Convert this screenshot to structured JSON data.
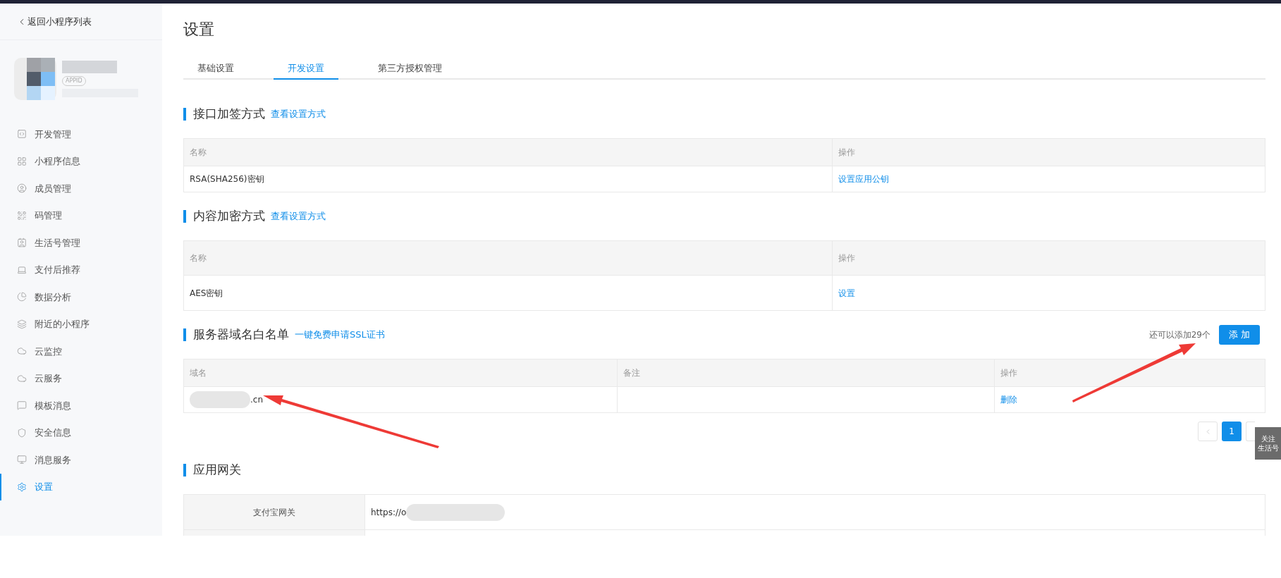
{
  "sidebar": {
    "back_link": "返回小程序列表",
    "app": {
      "badge": "APPID"
    },
    "items": [
      {
        "label": "开发管理",
        "selected": false
      },
      {
        "label": "小程序信息",
        "selected": false
      },
      {
        "label": "成员管理",
        "selected": false
      },
      {
        "label": "码管理",
        "selected": false
      },
      {
        "label": "生活号管理",
        "selected": false
      },
      {
        "label": "支付后推荐",
        "selected": false
      },
      {
        "label": "数据分析",
        "selected": false
      },
      {
        "label": "附近的小程序",
        "selected": false
      },
      {
        "label": "云监控",
        "selected": false
      },
      {
        "label": "云服务",
        "selected": false
      },
      {
        "label": "模板消息",
        "selected": false
      },
      {
        "label": "安全信息",
        "selected": false
      },
      {
        "label": "消息服务",
        "selected": false
      },
      {
        "label": "设置",
        "selected": true
      }
    ]
  },
  "page_title": "设置",
  "tabs": [
    {
      "label": "基础设置",
      "selected": false
    },
    {
      "label": "开发设置",
      "selected": true
    },
    {
      "label": "第三方授权管理",
      "selected": false
    }
  ],
  "sections": [
    {
      "title": "接口加签方式",
      "link": "查看设置方式",
      "table": {
        "columns": [
          "名称",
          "操作"
        ],
        "rows": [
          [
            {
              "kind": "text",
              "text": "RSA(SHA256)密钥"
            },
            {
              "kind": "link",
              "text": "设置应用公钥"
            }
          ]
        ]
      }
    },
    {
      "title": "内容加密方式",
      "link": "查看设置方式",
      "table": {
        "columns": [
          "名称",
          "操作"
        ],
        "rows": [
          [
            {
              "kind": "text",
              "text": "AES密钥"
            },
            {
              "kind": "link",
              "text": "设置"
            }
          ]
        ]
      }
    },
    {
      "title": "服务器域名白名单",
      "link": "一键免费申请SSL证书",
      "remaining": "还可以添加29个",
      "add_button": "添 加",
      "table": {
        "columns": [
          "域名",
          "备注",
          "操作"
        ],
        "rows": [
          [
            {
              "kind": "masked",
              "text": ".cn"
            },
            {
              "kind": "text",
              "text": ""
            },
            {
              "kind": "link",
              "text": "删除"
            }
          ]
        ]
      },
      "pagination": {
        "pages": [
          {
            "label": "1",
            "selected": true
          }
        ]
      }
    },
    {
      "title": "应用网关",
      "kv_rows": [
        {
          "label": "支付宝网关",
          "value": "https://o"
        }
      ]
    }
  ],
  "float_button": {
    "lines": [
      "关注",
      "生活号"
    ]
  }
}
